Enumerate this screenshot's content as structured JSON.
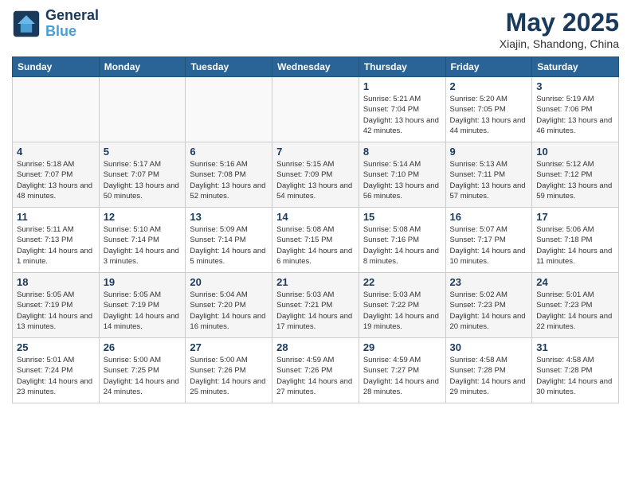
{
  "logo": {
    "line1": "General",
    "line2": "Blue"
  },
  "title": "May 2025",
  "subtitle": "Xiajin, Shandong, China",
  "days_of_week": [
    "Sunday",
    "Monday",
    "Tuesday",
    "Wednesday",
    "Thursday",
    "Friday",
    "Saturday"
  ],
  "weeks": [
    [
      {
        "day": "",
        "info": ""
      },
      {
        "day": "",
        "info": ""
      },
      {
        "day": "",
        "info": ""
      },
      {
        "day": "",
        "info": ""
      },
      {
        "day": "1",
        "info": "Sunrise: 5:21 AM\nSunset: 7:04 PM\nDaylight: 13 hours\nand 42 minutes."
      },
      {
        "day": "2",
        "info": "Sunrise: 5:20 AM\nSunset: 7:05 PM\nDaylight: 13 hours\nand 44 minutes."
      },
      {
        "day": "3",
        "info": "Sunrise: 5:19 AM\nSunset: 7:06 PM\nDaylight: 13 hours\nand 46 minutes."
      }
    ],
    [
      {
        "day": "4",
        "info": "Sunrise: 5:18 AM\nSunset: 7:07 PM\nDaylight: 13 hours\nand 48 minutes."
      },
      {
        "day": "5",
        "info": "Sunrise: 5:17 AM\nSunset: 7:07 PM\nDaylight: 13 hours\nand 50 minutes."
      },
      {
        "day": "6",
        "info": "Sunrise: 5:16 AM\nSunset: 7:08 PM\nDaylight: 13 hours\nand 52 minutes."
      },
      {
        "day": "7",
        "info": "Sunrise: 5:15 AM\nSunset: 7:09 PM\nDaylight: 13 hours\nand 54 minutes."
      },
      {
        "day": "8",
        "info": "Sunrise: 5:14 AM\nSunset: 7:10 PM\nDaylight: 13 hours\nand 56 minutes."
      },
      {
        "day": "9",
        "info": "Sunrise: 5:13 AM\nSunset: 7:11 PM\nDaylight: 13 hours\nand 57 minutes."
      },
      {
        "day": "10",
        "info": "Sunrise: 5:12 AM\nSunset: 7:12 PM\nDaylight: 13 hours\nand 59 minutes."
      }
    ],
    [
      {
        "day": "11",
        "info": "Sunrise: 5:11 AM\nSunset: 7:13 PM\nDaylight: 14 hours\nand 1 minute."
      },
      {
        "day": "12",
        "info": "Sunrise: 5:10 AM\nSunset: 7:14 PM\nDaylight: 14 hours\nand 3 minutes."
      },
      {
        "day": "13",
        "info": "Sunrise: 5:09 AM\nSunset: 7:14 PM\nDaylight: 14 hours\nand 5 minutes."
      },
      {
        "day": "14",
        "info": "Sunrise: 5:08 AM\nSunset: 7:15 PM\nDaylight: 14 hours\nand 6 minutes."
      },
      {
        "day": "15",
        "info": "Sunrise: 5:08 AM\nSunset: 7:16 PM\nDaylight: 14 hours\nand 8 minutes."
      },
      {
        "day": "16",
        "info": "Sunrise: 5:07 AM\nSunset: 7:17 PM\nDaylight: 14 hours\nand 10 minutes."
      },
      {
        "day": "17",
        "info": "Sunrise: 5:06 AM\nSunset: 7:18 PM\nDaylight: 14 hours\nand 11 minutes."
      }
    ],
    [
      {
        "day": "18",
        "info": "Sunrise: 5:05 AM\nSunset: 7:19 PM\nDaylight: 14 hours\nand 13 minutes."
      },
      {
        "day": "19",
        "info": "Sunrise: 5:05 AM\nSunset: 7:19 PM\nDaylight: 14 hours\nand 14 minutes."
      },
      {
        "day": "20",
        "info": "Sunrise: 5:04 AM\nSunset: 7:20 PM\nDaylight: 14 hours\nand 16 minutes."
      },
      {
        "day": "21",
        "info": "Sunrise: 5:03 AM\nSunset: 7:21 PM\nDaylight: 14 hours\nand 17 minutes."
      },
      {
        "day": "22",
        "info": "Sunrise: 5:03 AM\nSunset: 7:22 PM\nDaylight: 14 hours\nand 19 minutes."
      },
      {
        "day": "23",
        "info": "Sunrise: 5:02 AM\nSunset: 7:23 PM\nDaylight: 14 hours\nand 20 minutes."
      },
      {
        "day": "24",
        "info": "Sunrise: 5:01 AM\nSunset: 7:23 PM\nDaylight: 14 hours\nand 22 minutes."
      }
    ],
    [
      {
        "day": "25",
        "info": "Sunrise: 5:01 AM\nSunset: 7:24 PM\nDaylight: 14 hours\nand 23 minutes."
      },
      {
        "day": "26",
        "info": "Sunrise: 5:00 AM\nSunset: 7:25 PM\nDaylight: 14 hours\nand 24 minutes."
      },
      {
        "day": "27",
        "info": "Sunrise: 5:00 AM\nSunset: 7:26 PM\nDaylight: 14 hours\nand 25 minutes."
      },
      {
        "day": "28",
        "info": "Sunrise: 4:59 AM\nSunset: 7:26 PM\nDaylight: 14 hours\nand 27 minutes."
      },
      {
        "day": "29",
        "info": "Sunrise: 4:59 AM\nSunset: 7:27 PM\nDaylight: 14 hours\nand 28 minutes."
      },
      {
        "day": "30",
        "info": "Sunrise: 4:58 AM\nSunset: 7:28 PM\nDaylight: 14 hours\nand 29 minutes."
      },
      {
        "day": "31",
        "info": "Sunrise: 4:58 AM\nSunset: 7:28 PM\nDaylight: 14 hours\nand 30 minutes."
      }
    ]
  ]
}
